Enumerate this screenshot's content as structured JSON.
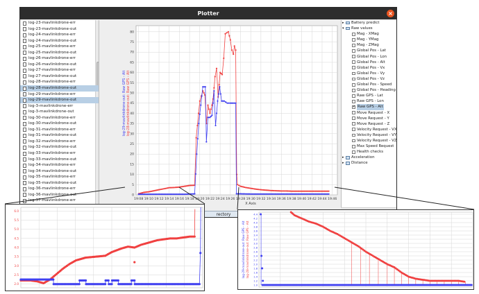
{
  "window": {
    "title": "Plotter",
    "close_glyph": "×",
    "directory_button": "rectory"
  },
  "file_list": [
    "log-23-mavlinkdrone-err",
    "log-23-mavlinkdrone-out",
    "log-24-mavlinkdrone-err",
    "log-24-mavlinkdrone-out",
    "log-25-mavlinkdrone-err",
    "log-25-mavlinkdrone-out",
    "log-26-mavlinkdrone-err",
    "log-26-mavlinkdrone-out",
    "log-27-mavlinkdrone-err",
    "log-27-mavlinkdrone-out",
    "log-28-mavlinkdrone-err",
    "log-28-mavlinkdrone-out",
    "log-29-mavlinkdrone-err",
    "log-29-mavlinkdrone-out",
    "log-3-mavlinkdrone-err",
    "log-3-mavlinkdrone-out",
    "log-30-mavlinkdrone-err",
    "log-30-mavlinkdrone-out",
    "log-31-mavlinkdrone-err",
    "log-31-mavlinkdrone-out",
    "log-32-mavlinkdrone-err",
    "log-32-mavlinkdrone-out",
    "log-33-mavlinkdrone-err",
    "log-33-mavlinkdrone-out",
    "log-34-mavlinkdrone-err",
    "log-34-mavlinkdrone-out",
    "log-35-mavlinkdrone-err",
    "log-35-mavlinkdrone-out",
    "log-36-mavlinkdrone-err",
    "log-36-mavlinkdrone-out",
    "log-37-mavlinkdrone-err",
    "log-37-mavlinkdrone-out",
    "log-38-mavlinkdrone-err"
  ],
  "selected_files": [
    "log-28-mavlinkdrone-out",
    "log-29-mavlinkdrone-out"
  ],
  "tree": {
    "top_nodes": [
      {
        "label": "Battery predict",
        "expanded": false
      },
      {
        "label": "Raw values",
        "expanded": true
      }
    ],
    "raw_children": [
      {
        "label": "Mag - XMag",
        "checked": false
      },
      {
        "label": "Mag - YMag",
        "checked": false
      },
      {
        "label": "Mag - ZMag",
        "checked": false
      },
      {
        "label": "Global Pos - Lat",
        "checked": false
      },
      {
        "label": "Global Pos - Lon",
        "checked": false
      },
      {
        "label": "Global Pos - Alt",
        "checked": false
      },
      {
        "label": "Global Pos - Vx",
        "checked": false
      },
      {
        "label": "Global Pos - Vy",
        "checked": false
      },
      {
        "label": "Global Pos - Vz",
        "checked": false
      },
      {
        "label": "Global Pos - Speed",
        "checked": false
      },
      {
        "label": "Global Pos - Heading",
        "checked": false
      },
      {
        "label": "Raw GPS - Lat",
        "checked": false
      },
      {
        "label": "Raw GPS - Lon",
        "checked": false
      },
      {
        "label": "Raw GPS - Alt",
        "checked": true
      },
      {
        "label": "Move Request - X",
        "checked": false
      },
      {
        "label": "Move Request - Y",
        "checked": false
      },
      {
        "label": "Move Request - Z",
        "checked": false
      },
      {
        "label": "Velocity Request - VX",
        "checked": false
      },
      {
        "label": "Velocity Request - VY",
        "checked": false
      },
      {
        "label": "Velocity Request - VZ",
        "checked": false
      },
      {
        "label": "Max Speed Request",
        "checked": false
      },
      {
        "label": "Health checks",
        "checked": false
      }
    ],
    "bottom_nodes": [
      {
        "label": "Acceleration",
        "expanded": false
      },
      {
        "label": "Distance",
        "expanded": false
      }
    ],
    "selected": "Raw GPS - Alt",
    "check_glyph": "✔"
  },
  "plot": {
    "xlabel": "X Axis",
    "ylabel_blue": "log-29-mavlinkdrone-out: Raw GPS - Alt",
    "ylabel_red": "log-28-mavlinkdrone-out: Raw GPS - Alt",
    "x_ticks": [
      "19:08",
      "19:10",
      "19:12",
      "19:14",
      "19:16",
      "19:18",
      "19:20",
      "19:22",
      "19:24",
      "19:26",
      "19:28",
      "19:30",
      "19:32",
      "19:34",
      "19:36",
      "19:38",
      "19:40",
      "19:42",
      "19:44",
      "19:46"
    ],
    "y_ticks": [
      0,
      5,
      10,
      15,
      20,
      25,
      30,
      35,
      40,
      45,
      50,
      55,
      60,
      65,
      70,
      75,
      80
    ],
    "ylim": [
      0,
      83
    ],
    "colors": {
      "red": "#f04040",
      "blue": "#4040f0",
      "grid": "#d6d6d6"
    },
    "red_series": [
      [
        0,
        0.5
      ],
      [
        1,
        1.2
      ],
      [
        2,
        1.5
      ],
      [
        3,
        2
      ],
      [
        4,
        2.5
      ],
      [
        5,
        3
      ],
      [
        6,
        3.5
      ],
      [
        7,
        3.6
      ],
      [
        8,
        3.8
      ],
      [
        9,
        4.2
      ],
      [
        10,
        4.6
      ],
      [
        11,
        4.7
      ],
      [
        11.3,
        28
      ],
      [
        12,
        46
      ],
      [
        12.6,
        51
      ],
      [
        13,
        49
      ],
      [
        13.3,
        35
      ],
      [
        13.6,
        44
      ],
      [
        14,
        40
      ],
      [
        14.4,
        44
      ],
      [
        14.6,
        47
      ],
      [
        15,
        58
      ],
      [
        15.3,
        62
      ],
      [
        15.6,
        48
      ],
      [
        16,
        60
      ],
      [
        16.4,
        59
      ],
      [
        16.7,
        67
      ],
      [
        17,
        79
      ],
      [
        17.6,
        80
      ],
      [
        18,
        76
      ],
      [
        18.3,
        71
      ],
      [
        18.6,
        69
      ],
      [
        18.8,
        73
      ],
      [
        19.05,
        71
      ],
      [
        19.25,
        10
      ],
      [
        19.4,
        5
      ],
      [
        20,
        4.2
      ],
      [
        21,
        3.6
      ],
      [
        22,
        3.2
      ],
      [
        23,
        2.8
      ],
      [
        24,
        2.5
      ],
      [
        25,
        2.3
      ],
      [
        26,
        2.1
      ],
      [
        27,
        2
      ],
      [
        28,
        1.9
      ],
      [
        29,
        1.9
      ],
      [
        30,
        1.8
      ],
      [
        31,
        1.8
      ],
      [
        32,
        1.8
      ],
      [
        33,
        1.8
      ],
      [
        34,
        1.8
      ],
      [
        35,
        1.8
      ],
      [
        36,
        1.8
      ],
      [
        37,
        1.8
      ],
      [
        37.5,
        1.8
      ]
    ],
    "blue_series": [
      [
        0,
        0.3
      ],
      [
        1,
        0.3
      ],
      [
        2,
        0.3
      ],
      [
        3,
        0.3
      ],
      [
        4,
        0.3
      ],
      [
        5,
        0.3
      ],
      [
        6,
        0.3
      ],
      [
        7,
        0.3
      ],
      [
        8,
        0.3
      ],
      [
        9,
        0.3
      ],
      [
        10,
        0.4
      ],
      [
        11,
        0.5
      ],
      [
        11.4,
        20
      ],
      [
        11.8,
        35
      ],
      [
        12.2,
        44
      ],
      [
        12.6,
        53
      ],
      [
        13.1,
        53
      ],
      [
        13.3,
        26
      ],
      [
        13.6,
        38
      ],
      [
        14,
        38
      ],
      [
        14.4,
        39
      ],
      [
        14.8,
        51
      ],
      [
        15.1,
        34
      ],
      [
        15.5,
        46
      ],
      [
        15.9,
        53
      ],
      [
        16.3,
        46
      ],
      [
        16.8,
        46
      ],
      [
        17.4,
        45
      ],
      [
        18,
        45
      ],
      [
        18.5,
        45
      ],
      [
        19.05,
        45
      ],
      [
        19.2,
        0.5
      ],
      [
        20,
        0.5
      ],
      [
        22,
        0.4
      ],
      [
        25,
        0.4
      ],
      [
        28,
        0.4
      ],
      [
        31,
        0.4
      ],
      [
        34,
        0.4
      ],
      [
        37.5,
        0.4
      ]
    ]
  },
  "zoom_left": {
    "y_ticks": [
      "6.0",
      "5.5",
      "5.0",
      "4.5",
      "4.0",
      "3.5",
      "3.0",
      "2.5",
      "2.0"
    ],
    "ylim": [
      1.8,
      6.2
    ],
    "red_series": [
      [
        0,
        2.2
      ],
      [
        3,
        2.2
      ],
      [
        5,
        2.15
      ],
      [
        7,
        2.05
      ],
      [
        9,
        2.25
      ],
      [
        11,
        2.55
      ],
      [
        13,
        2.85
      ],
      [
        15,
        3.1
      ],
      [
        17,
        3.3
      ],
      [
        20,
        3.45
      ],
      [
        23,
        3.5
      ],
      [
        26,
        3.55
      ],
      [
        28,
        3.75
      ],
      [
        31,
        3.95
      ],
      [
        33,
        4.05
      ],
      [
        35,
        4.0
      ],
      [
        37,
        4.15
      ],
      [
        40,
        4.3
      ],
      [
        42,
        4.4
      ],
      [
        44,
        4.45
      ],
      [
        46,
        4.5
      ],
      [
        48,
        4.5
      ],
      [
        50,
        4.55
      ],
      [
        52,
        4.6
      ],
      [
        53.5,
        4.6
      ],
      [
        53.6,
        6.1
      ]
    ],
    "red_outlier": [
      [
        35,
        3.2
      ]
    ],
    "blue_series": [
      [
        0,
        2.25
      ],
      [
        10,
        2.25
      ],
      [
        10.1,
        2.0
      ],
      [
        15,
        2.0
      ],
      [
        18,
        2.0
      ],
      [
        18.1,
        2.2
      ],
      [
        20,
        2.2
      ],
      [
        20.1,
        2.0
      ],
      [
        26,
        2.0
      ],
      [
        26.1,
        2.2
      ],
      [
        27,
        2.2
      ],
      [
        27.1,
        2.0
      ],
      [
        28,
        2.0
      ],
      [
        28.1,
        2.2
      ],
      [
        30,
        2.2
      ],
      [
        30.1,
        2.0
      ],
      [
        34,
        2.0
      ],
      [
        34.1,
        2.2
      ],
      [
        35,
        2.2
      ],
      [
        35.1,
        2.0
      ],
      [
        55,
        2.0
      ],
      [
        55.3,
        3.7
      ],
      [
        55.4,
        6.2
      ]
    ],
    "xlim": [
      0,
      56
    ]
  },
  "zoom_right": {
    "ylabel": "log-29-mavlinkdrone-out: Raw GPS - Alt",
    "ylabel_red": "log-28-mavlinkdrone-out: Raw GPS - Alt",
    "y_ticks": [
      "4.4",
      "4.2",
      "4.0",
      "3.8",
      "3.6",
      "3.4",
      "3.2",
      "3.0",
      "2.8",
      "2.6",
      "2.4",
      "2.2",
      "2.0",
      "1.8",
      "1.6",
      "1.4",
      "1.2",
      "1.0"
    ],
    "ylim": [
      0.9,
      4.5
    ],
    "xlim": [
      0,
      60
    ],
    "red_series": [
      [
        9,
        4.5
      ],
      [
        10,
        4.35
      ],
      [
        12,
        4.2
      ],
      [
        14,
        4.05
      ],
      [
        16,
        3.95
      ],
      [
        18,
        3.8
      ],
      [
        20,
        3.6
      ],
      [
        22,
        3.45
      ],
      [
        24,
        3.25
      ],
      [
        26,
        3.05
      ],
      [
        28,
        2.85
      ],
      [
        30,
        2.6
      ],
      [
        32,
        2.4
      ],
      [
        34,
        2.2
      ],
      [
        36,
        2.0
      ],
      [
        38,
        1.85
      ],
      [
        40,
        1.6
      ],
      [
        42,
        1.4
      ],
      [
        44,
        1.3
      ],
      [
        46,
        1.25
      ],
      [
        48,
        1.2
      ],
      [
        50,
        1.2
      ],
      [
        52,
        1.2
      ],
      [
        54,
        1.2
      ],
      [
        56,
        1.2
      ],
      [
        58,
        1.15
      ]
    ],
    "spikes_x": [
      26,
      28.5,
      31,
      33.5,
      36,
      38,
      40,
      42,
      44,
      46,
      48,
      50,
      52,
      54,
      56,
      58
    ],
    "blue_series": [
      [
        1,
        1.0
      ],
      [
        60,
        1.0
      ]
    ],
    "blue_left": [
      [
        0.5,
        4.4
      ],
      [
        0.7,
        2.4
      ],
      [
        0.9,
        1.8
      ],
      [
        1.1,
        1.2
      ]
    ]
  }
}
